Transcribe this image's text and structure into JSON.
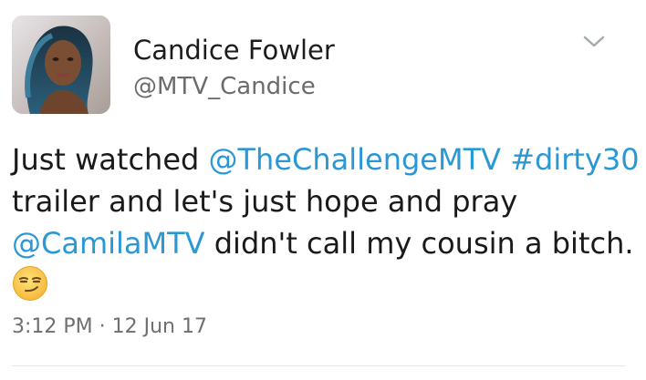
{
  "author": {
    "display_name": "Candice Fowler",
    "handle": "@MTV_Candice",
    "avatar_icon": "profile-photo"
  },
  "menu": {
    "icon": "chevron-down-icon"
  },
  "tweet": {
    "line1": {
      "text_a": "Just watched ",
      "mention_1": "@TheChallengeMTV",
      "space": " ",
      "hashtag": "#dirty30"
    },
    "line2": {
      "text": "trailer and let's just hope and pray"
    },
    "line3": {
      "mention_2": "@CamilaMTV",
      "text": " didn't call my cousin a bitch."
    },
    "emoji": "smirking-face-emoji"
  },
  "timestamp": "3:12 PM · 12 Jun 17",
  "colors": {
    "link": "#2b98d6",
    "text": "#1a1a1a",
    "muted": "#6f6f6f",
    "divider": "#e1e8ed"
  }
}
